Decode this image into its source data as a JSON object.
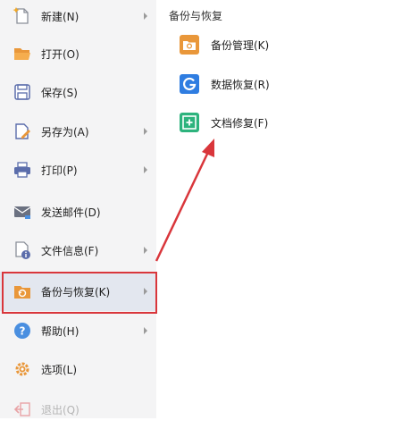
{
  "menu": {
    "items": [
      {
        "label": "新建(N)",
        "icon": "new-document-icon",
        "has_submenu": true
      },
      {
        "label": "打开(O)",
        "icon": "folder-open-icon",
        "has_submenu": false
      },
      {
        "label": "保存(S)",
        "icon": "save-icon",
        "has_submenu": false
      },
      {
        "label": "另存为(A)",
        "icon": "save-as-icon",
        "has_submenu": true
      },
      {
        "label": "打印(P)",
        "icon": "printer-icon",
        "has_submenu": true
      },
      {
        "label": "发送邮件(D)",
        "icon": "mail-icon",
        "has_submenu": false
      },
      {
        "label": "文件信息(F)",
        "icon": "file-info-icon",
        "has_submenu": true
      },
      {
        "label": "备份与恢复(K)",
        "icon": "backup-restore-icon",
        "has_submenu": true,
        "selected": true
      },
      {
        "label": "帮助(H)",
        "icon": "help-icon",
        "has_submenu": true
      },
      {
        "label": "选项(L)",
        "icon": "gear-icon",
        "has_submenu": false
      },
      {
        "label": "退出(Q)",
        "icon": "exit-icon",
        "has_submenu": false,
        "disabled": true
      }
    ]
  },
  "submenu": {
    "title": "备份与恢复",
    "items": [
      {
        "label": "备份管理(K)",
        "icon": "backup-manage-icon"
      },
      {
        "label": "数据恢复(R)",
        "icon": "data-recovery-icon"
      },
      {
        "label": "文档修复(F)",
        "icon": "document-repair-icon"
      }
    ]
  },
  "colors": {
    "highlight_border": "#d9363b",
    "annotation_arrow": "#d9363b",
    "menu_background": "#f4f4f5",
    "selected_background": "#e3e7ef"
  }
}
